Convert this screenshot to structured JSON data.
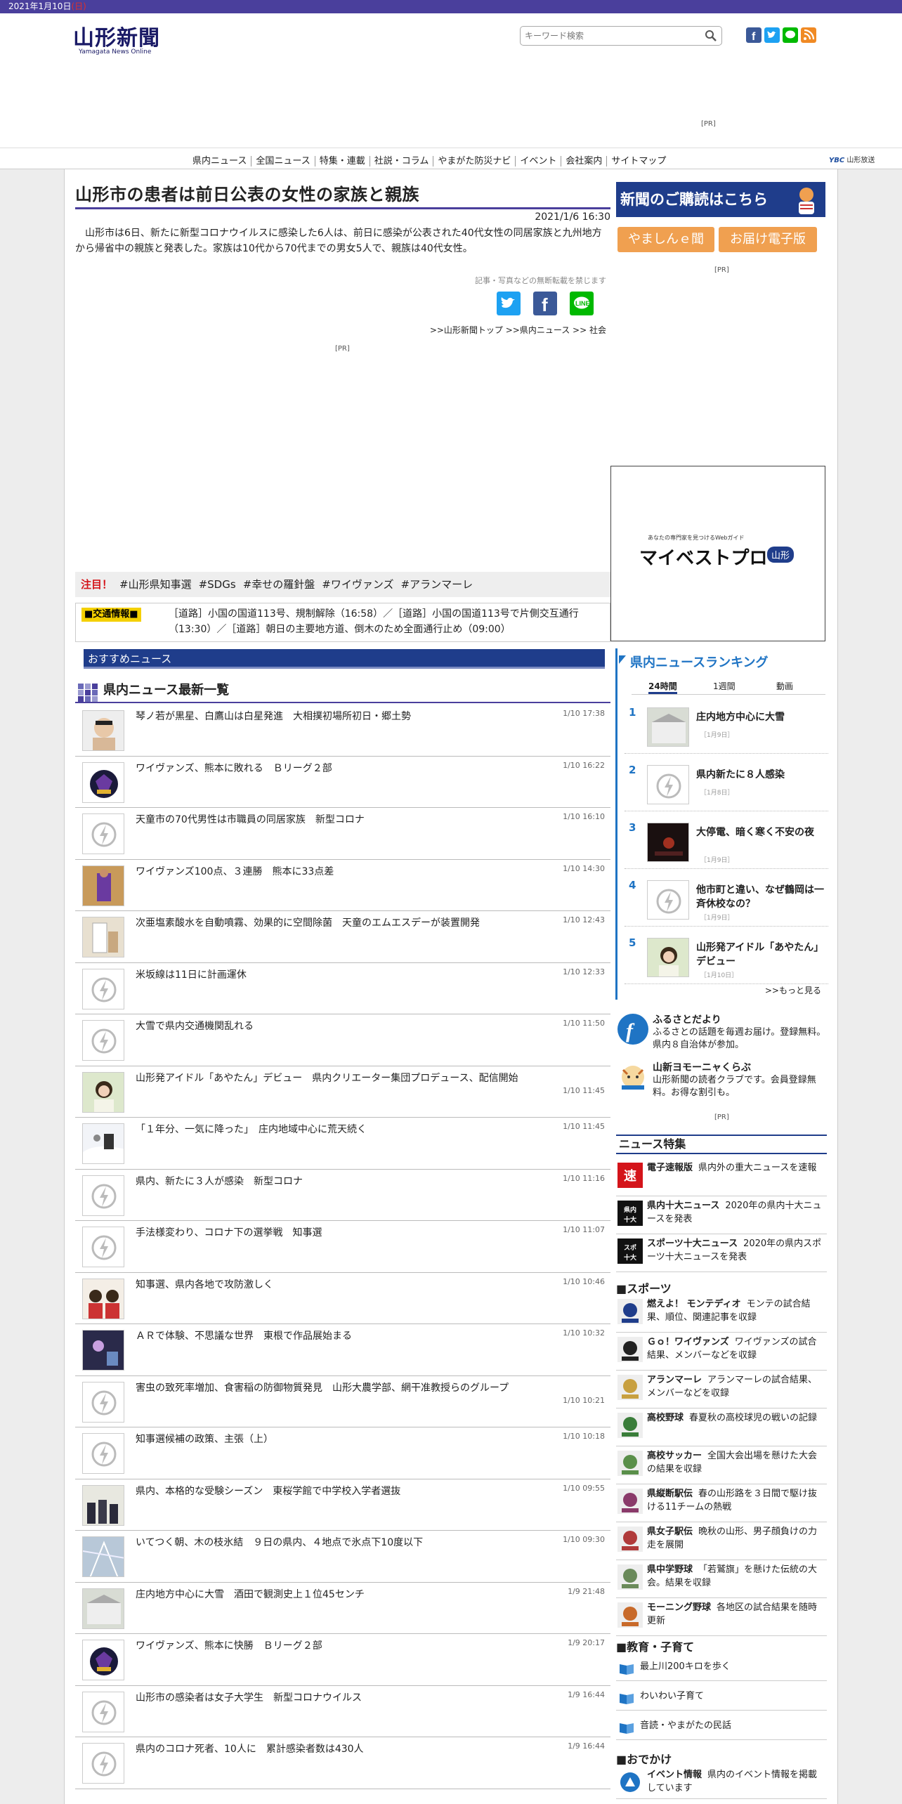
{
  "topbar": {
    "date": "2021年1月10日",
    "weekday": "(日)"
  },
  "header": {
    "logo_jp": "山形新聞",
    "logo_en": "Yamagata News Online",
    "search_placeholder": "キーワード検索"
  },
  "ad": {
    "pr": "[PR]"
  },
  "gnav": {
    "items": [
      "県内ニュース",
      "全国ニュース",
      "特集・連載",
      "社説・コラム",
      "やまがた防災ナビ",
      "イベント",
      "会社案内",
      "サイトマップ"
    ],
    "yab_logo": "YBC",
    "yab": "山形放送"
  },
  "article": {
    "title": "山形市の患者は前日公表の女性の家族と親族",
    "date": "2021/1/6 16:30",
    "body": "山形市は6日、新たに新型コロナウイルスに感染した6人は、前日に感染が公表された40代女性の同居家族と九州地方から帰省中の親族と発表した。家族は10代から70代までの男女5人で、親族は40代女性。",
    "note": "記事・写真などの無断転載を禁じます",
    "breadcrumb": ">>山形新聞トップ >>県内ニュース >> 社会",
    "pr": "[PR]"
  },
  "tags": {
    "label": "注目！",
    "items": [
      "#山形県知事選",
      "#SDGs",
      "#幸せの羅針盤",
      "#ワイヴァンズ",
      "#アランマーレ"
    ]
  },
  "traffic": {
    "label": "■交通情報■",
    "text": "［道路］小国の国道113号、規制解除（16:58）／［道路］小国の国道113号で片側交互通行（13:30）／［道路］朝日の主要地方道、倒木のため全面通行止め（09:00）"
  },
  "recommend": {
    "label": "おすすめニュース"
  },
  "newslist": {
    "heading": "県内ニュース最新一覧",
    "items": [
      {
        "title": "琴ノ若が黒星、白鷹山は白星発進　大相撲初場所初日・郷土勢",
        "time": "1/10 17:38",
        "thumb": "sumo"
      },
      {
        "title": "ワイヴァンズ、熊本に敗れる　Ｂリーグ２部",
        "time": "1/10 16:22",
        "thumb": "wyverns"
      },
      {
        "title": "天童市の70代男性は市職員の同居家族　新型コロナ",
        "time": "1/10 16:10",
        "thumb": "default"
      },
      {
        "title": "ワイヴァンズ100点、３連勝　熊本に33点差",
        "time": "1/10 14:30",
        "thumb": "basket"
      },
      {
        "title": "次亜塩素酸水を自動噴霧、効果的に空間除菌　天童のエムエスデーが装置開発",
        "time": "1/10 12:43",
        "thumb": "device"
      },
      {
        "title": "米坂線は11日に計画運休",
        "time": "1/10 12:33",
        "thumb": "default"
      },
      {
        "title": "大雪で県内交通機関乱れる",
        "time": "1/10 11:50",
        "thumb": "default"
      },
      {
        "title": "山形発アイドル「あやたん」デビュー　県内クリエーター集団プロデュース、配信開始",
        "time": "1/10 11:45",
        "thumb": "idol",
        "two": true
      },
      {
        "title": "「１年分、一気に降った」　庄内地域中心に荒天続く",
        "time": "1/10 11:45",
        "thumb": "snow"
      },
      {
        "title": "県内、新たに３人が感染　新型コロナ",
        "time": "1/10 11:16",
        "thumb": "default"
      },
      {
        "title": "手法様変わり、コロナ下の選挙戦　知事選",
        "time": "1/10 11:07",
        "thumb": "default"
      },
      {
        "title": "知事選、県内各地で攻防激しく",
        "time": "1/10 10:46",
        "thumb": "politic"
      },
      {
        "title": "ＡＲで体験、不思議な世界　東根で作品展始まる",
        "time": "1/10 10:32",
        "thumb": "art"
      },
      {
        "title": "害虫の致死率増加、食害稲の防御物質発見　山形大農学部、網干准教授らのグループ",
        "time": "1/10 10:21",
        "thumb": "default",
        "two": true
      },
      {
        "title": "知事選候補の政策、主張（上）",
        "time": "1/10 10:18",
        "thumb": "default"
      },
      {
        "title": "県内、本格的な受験シーズン　東桜学館で中学校入学者選抜",
        "time": "1/10 09:55",
        "thumb": "exam"
      },
      {
        "title": "いてつく朝、木の枝氷結　９日の県内、４地点で氷点下10度以下",
        "time": "1/10 09:30",
        "thumb": "frost"
      },
      {
        "title": "庄内地方中心に大雪　酒田で観測史上１位45センチ",
        "time": "1/9 21:48",
        "thumb": "snow2"
      },
      {
        "title": "ワイヴァンズ、熊本に快勝　Ｂリーグ２部",
        "time": "1/9 20:17",
        "thumb": "wyverns"
      },
      {
        "title": "山形市の感染者は女子大学生　新型コロナウイルス",
        "time": "1/9 16:44",
        "thumb": "default"
      },
      {
        "title": "県内のコロナ死者、10人に　累計感染者数は430人",
        "time": "1/9 16:44",
        "thumb": "default"
      }
    ]
  },
  "side": {
    "subscribe": "新聞のご購読はこちら",
    "btn1": "やましんｅ聞",
    "btn2": "お届け電子版",
    "pr1": "[PR]",
    "mypro": {
      "small": "あなたの専門家を見つけるWebガイド",
      "logo": "マイベストプロ",
      "area": "山形"
    },
    "ranking": {
      "title": "県内ニュースランキング",
      "tabs": [
        "24時間",
        "1週間",
        "動画"
      ],
      "items": [
        {
          "rank": "1",
          "title": "庄内地方中心に大雪",
          "date": "［1月9日］",
          "thumb": "snow2"
        },
        {
          "rank": "2",
          "title": "県内新たに８人感染",
          "date": "［1月8日］",
          "thumb": "default"
        },
        {
          "rank": "3",
          "title": "大停電、暗く寒く不安の夜",
          "date": "［1月9日］",
          "thumb": "dark"
        },
        {
          "rank": "4",
          "title": "他市町と違い、なぜ鶴岡は一斉休校なの？",
          "date": "［1月9日］",
          "thumb": "default"
        },
        {
          "rank": "5",
          "title": "山形発アイドル「あやたん」デビュー",
          "date": "［1月10日］",
          "thumb": "idol"
        }
      ],
      "more": ">>もっと見る"
    },
    "furusato": {
      "title": "ふるさとだより",
      "desc": "ふるさとの話題を毎週お届け。登録無料。県内８自治体が参加。"
    },
    "yomo": {
      "title": "山新ヨモーニャくらぶ",
      "desc": "山形新聞の読者クラブです。会員登録無料。お得な割引も。"
    },
    "pr2": "[PR]",
    "features_heading": "ニュース特集",
    "features": [
      {
        "name": "電子速報版",
        "desc": "県内外の重大ニュースを速報",
        "icon": "速"
      },
      {
        "name": "県内十大ニュース",
        "desc": "2020年の県内十大ニュースを発表",
        "icon": "県内十大"
      },
      {
        "name": "スポーツ十大ニュース",
        "desc": "2020年の県内スポーツ十大ニュースを発表",
        "icon": "スポ十大"
      }
    ],
    "sports_heading": "■スポーツ",
    "sports": [
      {
        "name": "燃えよ！ モンテディオ",
        "desc": "モンテの試合結果、順位、関連記事を収録",
        "color": "#1f3d8b"
      },
      {
        "name": "Ｇｏ！ワイヴァンズ",
        "desc": "ワイヴァンズの試合結果、メンバーなどを収録",
        "color": "#222"
      },
      {
        "name": "アランマーレ",
        "desc": "アランマーレの試合結果、メンバーなどを収録",
        "color": "#c8a040"
      },
      {
        "name": "高校野球",
        "desc": "春夏秋の高校球児の戦いの記録",
        "color": "#3a7d3a"
      },
      {
        "name": "高校サッカー",
        "desc": "全国大会出場を懸けた大会の結果を収録",
        "color": "#5a8f4a"
      },
      {
        "name": "県縦断駅伝",
        "desc": "春の山形路を３日間で駆け抜ける11チームの熱戦",
        "color": "#8a3a6a"
      },
      {
        "name": "県女子駅伝",
        "desc": "晩秋の山形、男子顔負けの力走を展開",
        "color": "#b03a3a"
      },
      {
        "name": "県中学野球",
        "desc": "「若鷲旗」を懸けた伝統の大会。結果を収録",
        "color": "#6a8a5a"
      },
      {
        "name": "モーニング野球",
        "desc": "各地区の試合結果を随時更新",
        "color": "#c86a2a"
      }
    ],
    "edu_heading": "■教育・子育て",
    "edu": [
      "最上川200キロを歩く",
      "わいわい子育て",
      "音読・やまがたの民話"
    ],
    "outing_heading": "■おでかけ",
    "outing": {
      "name": "イベント情報",
      "desc": "県内のイベント情報を掲載しています"
    }
  },
  "colors": {
    "brand": "#4a3f9c",
    "navy": "#1f3d8b",
    "rank_blue": "#1f74c4",
    "orange": "#f0a050"
  }
}
